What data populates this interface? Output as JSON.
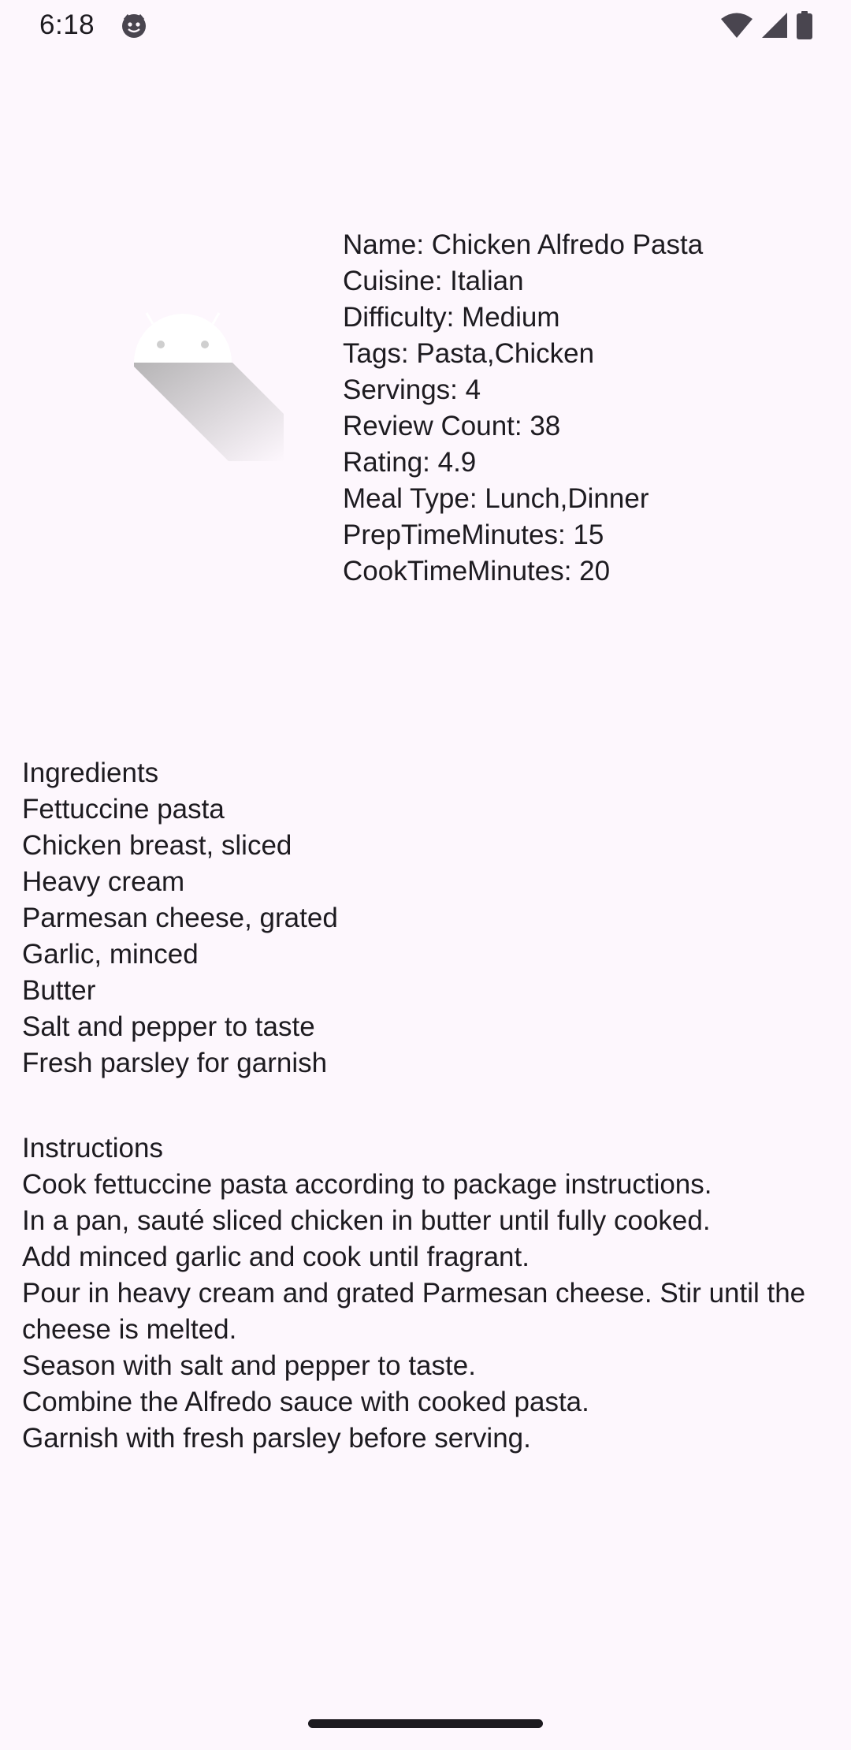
{
  "status_bar": {
    "time": "6:18",
    "icons": [
      "smiley-face-icon",
      "wifi-icon",
      "signal-icon",
      "battery-icon"
    ]
  },
  "recipe_image": {
    "icon": "android-placeholder-icon"
  },
  "details": {
    "name": "Name: Chicken Alfredo Pasta",
    "cuisine": "Cuisine: Italian",
    "difficulty": "Difficulty: Medium",
    "tags": "Tags: Pasta,Chicken",
    "servings": "Servings: 4",
    "review_count": "Review Count: 38",
    "rating": "Rating: 4.9",
    "meal_type": "Meal Type: Lunch,Dinner",
    "prep_time": "PrepTimeMinutes: 15",
    "cook_time": "CookTimeMinutes: 20"
  },
  "ingredients": {
    "heading": "Ingredients",
    "items": [
      "Fettuccine pasta",
      "Chicken breast, sliced",
      "Heavy cream",
      "Parmesan cheese, grated",
      "Garlic, minced",
      "Butter",
      "Salt and pepper to taste",
      "Fresh parsley for garnish"
    ]
  },
  "instructions": {
    "heading": "Instructions",
    "steps": [
      "Cook fettuccine pasta according to package instructions.",
      "In a pan, sauté sliced chicken in butter until fully cooked.",
      "Add minced garlic and cook until fragrant.",
      "Pour in heavy cream and grated Parmesan cheese. Stir until the cheese is melted.",
      "Season with salt and pepper to taste.",
      "Combine the Alfredo sauce with cooked pasta.",
      "Garnish with fresh parsley before serving."
    ]
  }
}
